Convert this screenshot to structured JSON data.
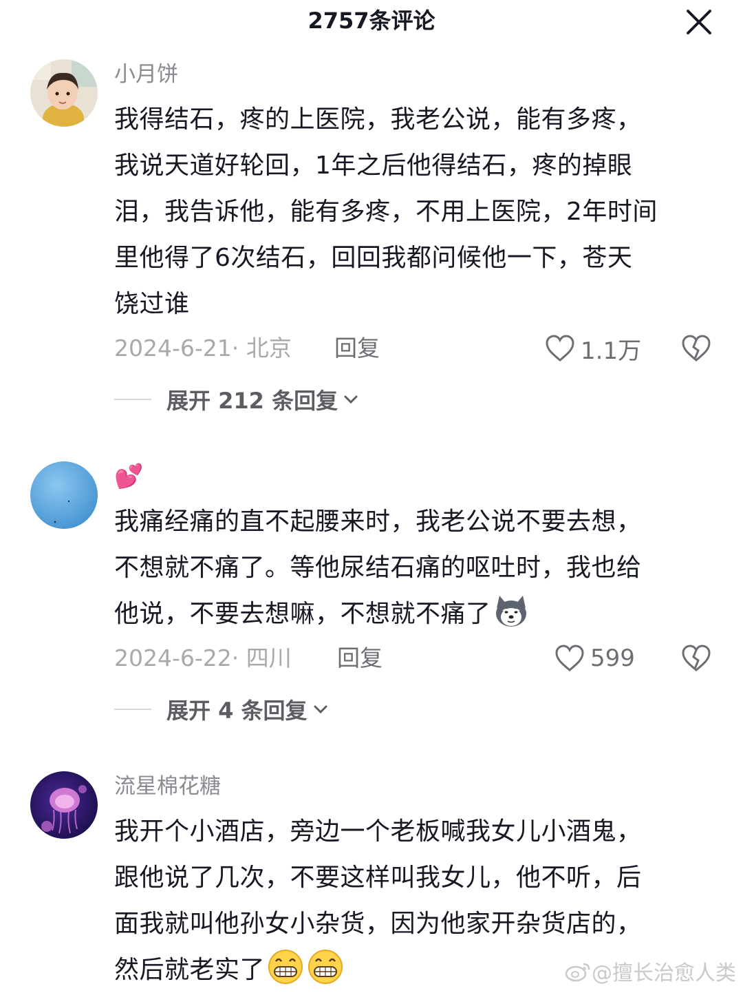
{
  "header": {
    "title": "2757条评论",
    "close_icon": "close-icon"
  },
  "comments": [
    {
      "username": "小月饼",
      "lines": [
        "我得结石，疼的上医院，我老公说，能有多疼，",
        "我说天道好轮回，1年之后他得结石，疼的掉眼",
        "泪，我告诉他，能有多疼，不用上医院，2年时间",
        "里他得了6次结石，回回我都问候他一下，苍天",
        "饶过谁"
      ],
      "date_location": "2024-6-21· 北京",
      "reply_label": "回复",
      "likes": "1.1万",
      "expand_label": "展开 212 条回复"
    },
    {
      "username": "💕",
      "lines": [
        "我痛经痛的直不起腰来时，我老公说不要去想，",
        "不想就不痛了。等他尿结石痛的呕吐时，我也给",
        "他说，不要去想嘛，不想就不痛了"
      ],
      "date_location": "2024-6-22· 四川",
      "reply_label": "回复",
      "likes": "599",
      "expand_label": "展开 4 条回复",
      "emoji": "husky-emoji"
    },
    {
      "username": "流星棉花糖",
      "lines": [
        "我开个小酒店，旁边一个老板喊我女儿小酒鬼，",
        "跟他说了几次，不要这样叫我女儿，他不听，后",
        "面我就叫他孙女小杂货，因为他家开杂货店的，",
        "然后就老实了"
      ],
      "emoji": "grin-emoji"
    }
  ],
  "watermark": {
    "text": "@擅长治愈人类",
    "icon": "weibo-icon"
  }
}
